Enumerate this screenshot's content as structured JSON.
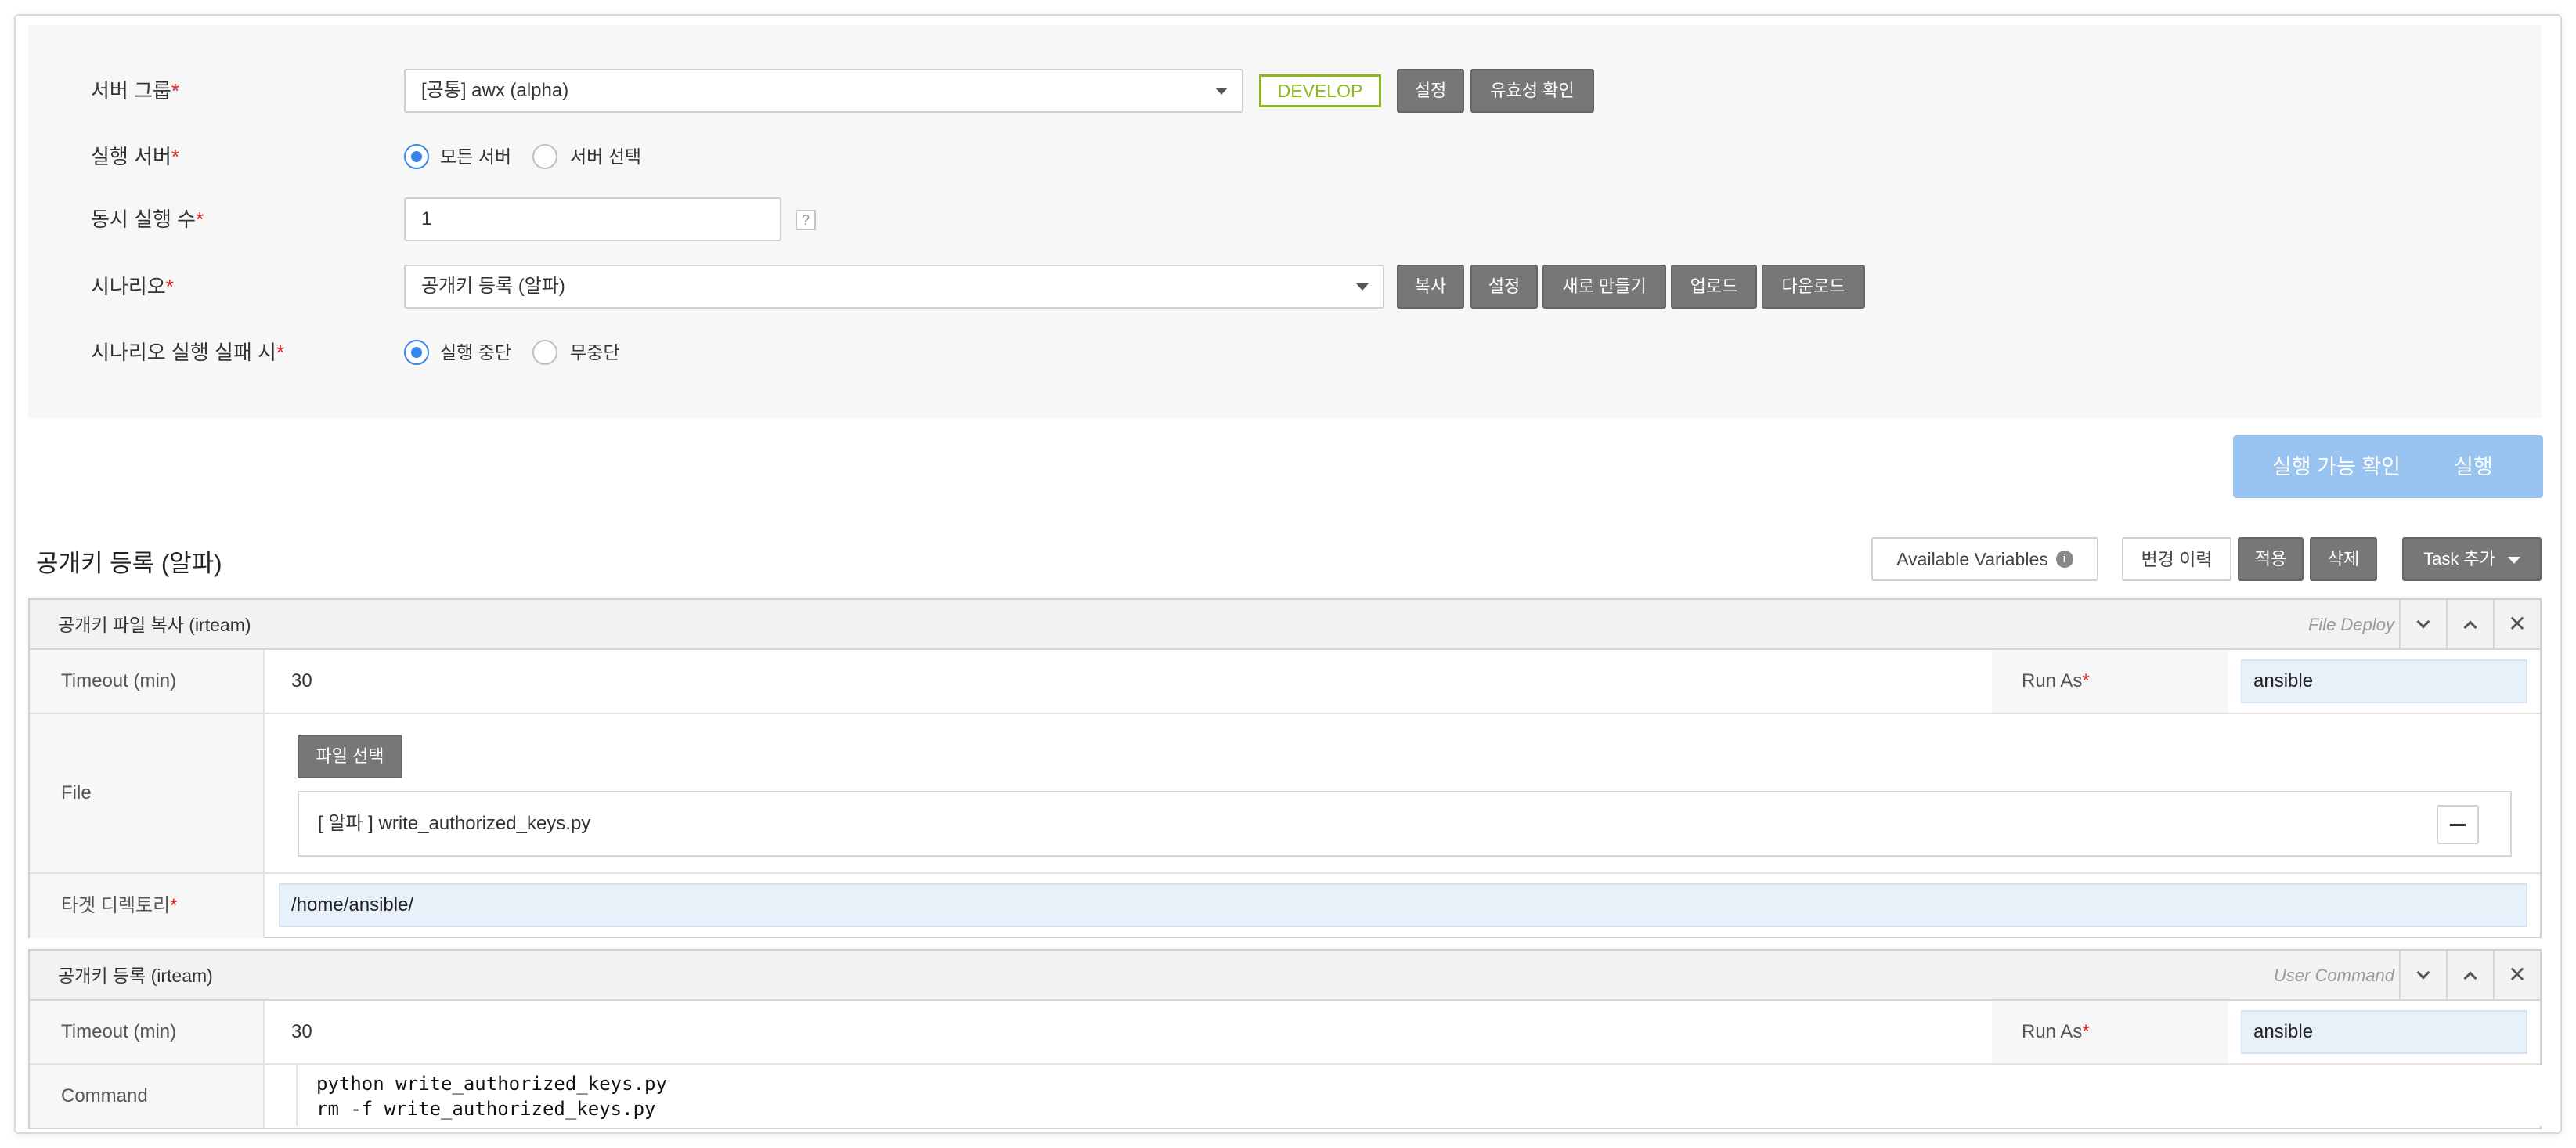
{
  "form": {
    "server_group": {
      "label": "서버 그룹",
      "value": "[공통] awx (alpha)",
      "env_badge": "DEVELOP",
      "settings_btn": "설정",
      "validate_btn": "유효성 확인"
    },
    "exec_server": {
      "label": "실행 서버",
      "option_all": "모든 서버",
      "option_select": "서버 선택",
      "selected": "option_all"
    },
    "concurrency": {
      "label": "동시 실행 수",
      "value": "1",
      "help_icon": "?"
    },
    "scenario": {
      "label": "시나리오",
      "value": "공개키 등록 (알파)",
      "buttons": [
        "복사",
        "설정",
        "새로 만들기",
        "업로드",
        "다운로드"
      ]
    },
    "on_failure": {
      "label": "시나리오 실행 실패 시",
      "option_stop": "실행 중단",
      "option_continue": "무중단",
      "selected": "option_stop"
    },
    "required_mark": "*"
  },
  "actions": {
    "check_btn": "실행 가능 확인",
    "run_btn": "실행"
  },
  "scenario_panel": {
    "title": "공개키 등록 (알파)",
    "available_vars_btn": "Available Variables",
    "info_icon": "i",
    "history_btn": "변경 이력",
    "apply_btn": "적용",
    "delete_btn": "삭제",
    "add_task_btn": "Task 추가"
  },
  "tasks": [
    {
      "name": "공개키 파일 복사 (irteam)",
      "type": "File Deploy",
      "timeout_label": "Timeout (min)",
      "timeout_value": "30",
      "runas_label": "Run As",
      "runas_value": "ansible",
      "file_label": "File",
      "file_select_btn": "파일 선택",
      "file_item": "[ 알파 ] write_authorized_keys.py",
      "target_dir_label": "타겟 디렉토리",
      "target_dir_value": "/home/ansible/"
    },
    {
      "name": "공개키 등록 (irteam)",
      "type": "User Command",
      "timeout_label": "Timeout (min)",
      "timeout_value": "30",
      "runas_label": "Run As",
      "runas_value": "ansible",
      "command_label": "Command",
      "command_lines": [
        "python write_authorized_keys.py",
        "rm -f write_authorized_keys.py"
      ]
    }
  ],
  "icons": {
    "close": "✕",
    "move_down": "chevron-down-icon",
    "move_up": "chevron-up-icon"
  },
  "colors": {
    "accent_blue": "#3a86e8",
    "action_blue": "#99c4f1",
    "develop_green": "#8db51c",
    "dark_button": "#777777",
    "required_red": "#e02020"
  }
}
